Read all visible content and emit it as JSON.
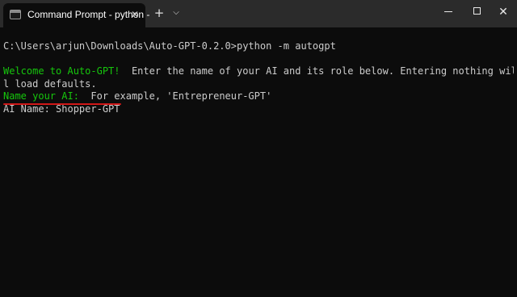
{
  "window": {
    "tab_title": "Command Prompt - python -",
    "tab_icon": "terminal-icon",
    "close_tab_glyph": "✕",
    "new_tab_glyph": "+",
    "dropdown_glyph": "⌵",
    "close_glyph": "✕"
  },
  "terminal": {
    "command_line": "C:\\Users\\arjun\\Downloads\\Auto-GPT-0.2.0>python -m autogpt",
    "welcome_label": "Welcome to Auto-GPT!",
    "welcome_text": "  Enter the name of your AI and its role below. Entering nothing wil",
    "welcome_cont": "l load defaults.",
    "name_prompt_label": "Name your AI:",
    "name_prompt_text": "  For example, 'Entrepreneur-GPT'",
    "ai_name_input": "AI Name: Shopper-GPT"
  },
  "colors": {
    "background": "#0c0c0c",
    "green_text": "#16c60c",
    "default_text": "#cccccc",
    "highlight_underline": "#d01818"
  }
}
